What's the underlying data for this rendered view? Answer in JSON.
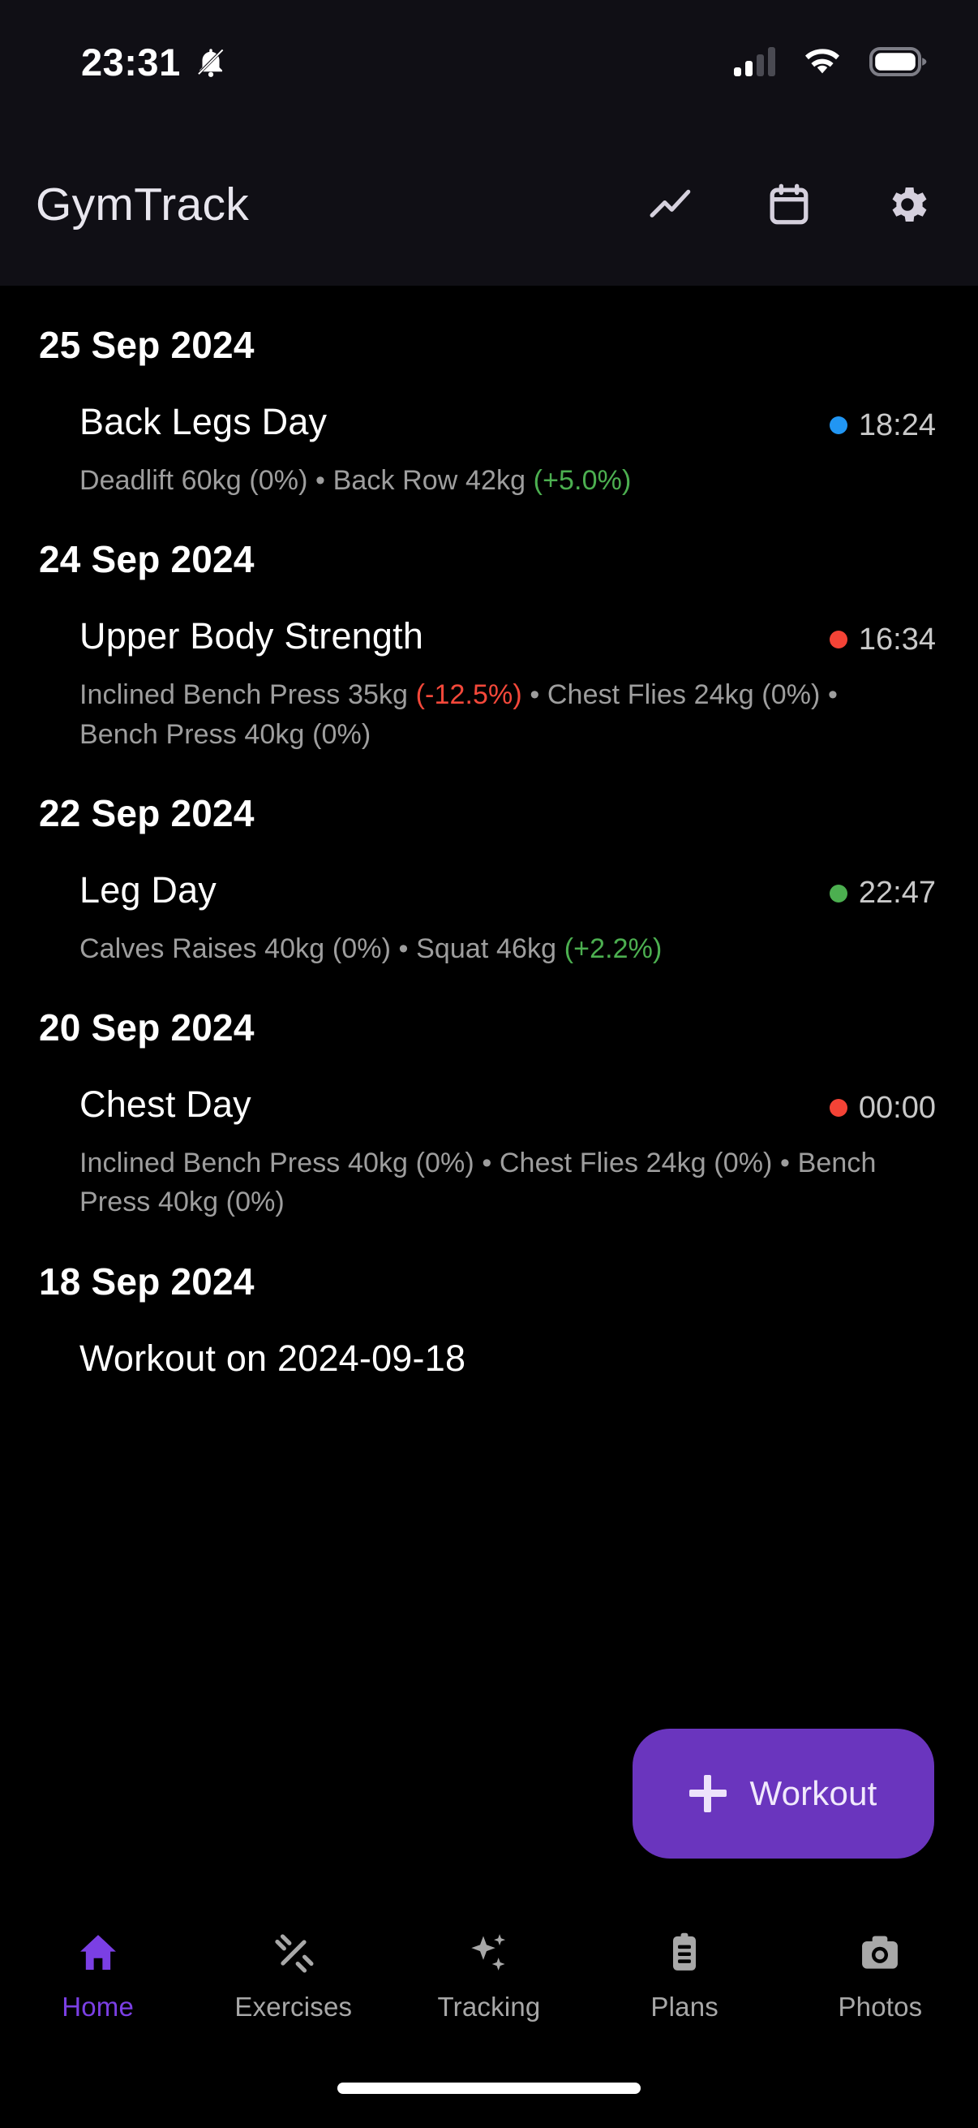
{
  "status_bar": {
    "time": "23:31",
    "icons": [
      "bell-off-icon",
      "signal-icon",
      "wifi-icon",
      "battery-icon"
    ],
    "signal_bars_active": 2,
    "signal_bars_total": 4
  },
  "header": {
    "title": "GymTrack",
    "actions": [
      {
        "name": "trending-up-icon",
        "label": "Stats"
      },
      {
        "name": "calendar-icon",
        "label": "Calendar"
      },
      {
        "name": "gear-icon",
        "label": "Settings"
      }
    ]
  },
  "colors": {
    "accent": "#6A35BE",
    "nav_active": "#7B3FE4",
    "positive": "#4CAF50",
    "negative": "#F4483A",
    "dot_blue": "#2196F3",
    "dot_red": "#F44336",
    "dot_green": "#4CAF50",
    "background": "#000000",
    "chrome": "#100F15"
  },
  "groups": [
    {
      "date": "25 Sep 2024",
      "entries": [
        {
          "title": "Back Legs Day",
          "time": "18:24",
          "dot_color": "#2196F3",
          "detail_parts": [
            {
              "text": "Deadlift 60kg  ",
              "style": "plain"
            },
            {
              "text": "(0%)",
              "style": "flat"
            },
            {
              "text": " • Back Row 42kg  ",
              "style": "plain"
            },
            {
              "text": "(+5.0%)",
              "style": "up"
            }
          ]
        }
      ]
    },
    {
      "date": "24 Sep 2024",
      "entries": [
        {
          "title": "Upper Body Strength",
          "time": "16:34",
          "dot_color": "#F44336",
          "detail_parts": [
            {
              "text": "Inclined Bench Press 35kg  ",
              "style": "plain"
            },
            {
              "text": "(-12.5%)",
              "style": "down"
            },
            {
              "text": " • Chest Flies 24kg  ",
              "style": "plain"
            },
            {
              "text": "(0%)",
              "style": "flat"
            },
            {
              "text": " • Bench Press 40kg  ",
              "style": "plain"
            },
            {
              "text": "(0%)",
              "style": "flat"
            }
          ]
        }
      ]
    },
    {
      "date": "22 Sep 2024",
      "entries": [
        {
          "title": "Leg Day",
          "time": "22:47",
          "dot_color": "#4CAF50",
          "detail_parts": [
            {
              "text": "Calves Raises 40kg  ",
              "style": "plain"
            },
            {
              "text": "(0%)",
              "style": "flat"
            },
            {
              "text": " • Squat 46kg  ",
              "style": "plain"
            },
            {
              "text": "(+2.2%)",
              "style": "up"
            }
          ]
        }
      ]
    },
    {
      "date": "20 Sep 2024",
      "entries": [
        {
          "title": "Chest Day",
          "time": "00:00",
          "dot_color": "#F44336",
          "detail_parts": [
            {
              "text": "Inclined Bench Press 40kg  ",
              "style": "plain"
            },
            {
              "text": "(0%)",
              "style": "flat"
            },
            {
              "text": " • Chest Flies 24kg  ",
              "style": "plain"
            },
            {
              "text": "(0%)",
              "style": "flat"
            },
            {
              "text": " • Bench Press 40kg  ",
              "style": "plain"
            },
            {
              "text": "(0%)",
              "style": "flat"
            }
          ]
        }
      ]
    },
    {
      "date": "18 Sep 2024",
      "entries": [
        {
          "title": "Workout on 2024-09-18",
          "time": "",
          "dot_color": "",
          "detail_parts": []
        }
      ]
    }
  ],
  "fab": {
    "label": "Workout",
    "icon": "plus-icon"
  },
  "bottom_nav": {
    "active_index": 0,
    "items": [
      {
        "label": "Home",
        "icon": "home-icon"
      },
      {
        "label": "Exercises",
        "icon": "dumbbell-icon"
      },
      {
        "label": "Tracking",
        "icon": "sparkles-icon"
      },
      {
        "label": "Plans",
        "icon": "clipboard-icon"
      },
      {
        "label": "Photos",
        "icon": "camera-icon"
      }
    ]
  }
}
